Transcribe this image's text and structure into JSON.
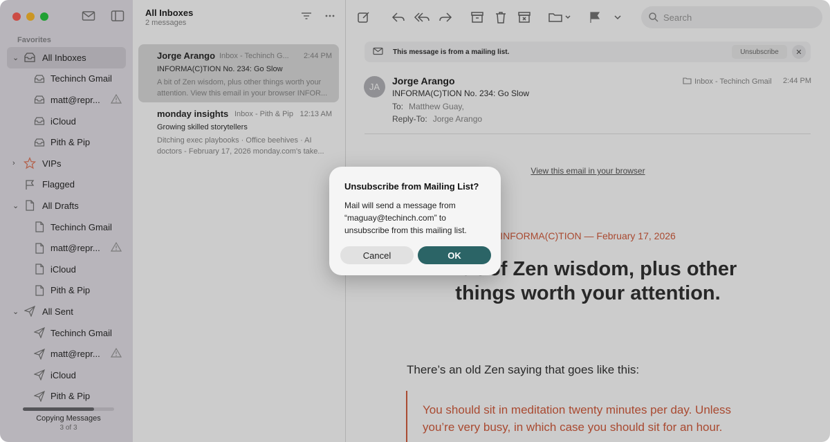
{
  "sidebar": {
    "section_label": "Favorites",
    "items": [
      {
        "label": "All Inboxes",
        "icon": "inbox-stack-icon",
        "level": "top",
        "chevron": "⌄",
        "selected": true
      },
      {
        "label": "Techinch Gmail",
        "icon": "inbox-icon",
        "level": "sub"
      },
      {
        "label": "matt@repr...",
        "icon": "inbox-icon",
        "level": "sub",
        "warning": true
      },
      {
        "label": "iCloud",
        "icon": "inbox-icon",
        "level": "sub"
      },
      {
        "label": "Pith & Pip",
        "icon": "inbox-icon",
        "level": "sub"
      },
      {
        "label": "VIPs",
        "icon": "star-icon",
        "level": "top",
        "chevron": "›"
      },
      {
        "label": "Flagged",
        "icon": "flag-icon",
        "level": "top"
      },
      {
        "label": "All Drafts",
        "icon": "document-icon",
        "level": "top",
        "chevron": "⌄"
      },
      {
        "label": "Techinch Gmail",
        "icon": "document-icon",
        "level": "sub"
      },
      {
        "label": "matt@repr...",
        "icon": "document-icon",
        "level": "sub",
        "warning": true
      },
      {
        "label": "iCloud",
        "icon": "document-icon",
        "level": "sub"
      },
      {
        "label": "Pith & Pip",
        "icon": "document-icon",
        "level": "sub"
      },
      {
        "label": "All Sent",
        "icon": "paperplane-icon",
        "level": "top",
        "chevron": "⌄"
      },
      {
        "label": "Techinch Gmail",
        "icon": "paperplane-icon",
        "level": "sub"
      },
      {
        "label": "matt@repr...",
        "icon": "paperplane-icon",
        "level": "sub",
        "warning": true
      },
      {
        "label": "iCloud",
        "icon": "paperplane-icon",
        "level": "sub"
      },
      {
        "label": "Pith & Pip",
        "icon": "paperplane-icon",
        "level": "sub"
      }
    ],
    "progress": {
      "label": "Copying Messages",
      "sub": "3 of 3",
      "fraction": 0.78
    }
  },
  "list": {
    "title": "All Inboxes",
    "count": "2 messages",
    "messages": [
      {
        "sender": "Jorge Arango",
        "mailbox": "Inbox - Techinch G...",
        "time": "2:44 PM",
        "subject": "INFORMA(C)TION No. 234: Go Slow",
        "preview": "A bit of Zen wisdom, plus other things worth your attention. View this email in your browser INFOR..."
      },
      {
        "sender": "monday insights",
        "mailbox": "Inbox - Pith & Pip",
        "time": "12:13 AM",
        "subject": "Growing skilled storytellers",
        "preview": "Ditching exec playbooks · Office beehives · AI doctors - February 17, 2026 monday.com's take..."
      }
    ]
  },
  "pane": {
    "search_placeholder": "Search",
    "banner_text": "This message is from a mailing list.",
    "unsubscribe_label": "Unsubscribe",
    "close_glyph": "✕",
    "avatar_initials": "JA",
    "sender": "Jorge Arango",
    "subject": "INFORMA(C)TION No. 234: Go Slow",
    "to_label": "To:",
    "to_value": "Matthew Guay,",
    "reply_to_label": "Reply-To:",
    "reply_to_value": "Jorge Arango",
    "mailbox": "Inbox - Techinch Gmail",
    "time": "2:44 PM",
    "view_in_browser": "View this email in your browser",
    "issue_line": "INFORMA(C)TION — February 17, 2026",
    "headline": "A bit of Zen wisdom, plus other things worth your attention.",
    "body_intro": "There’s an old Zen saying that goes like this:",
    "quote": "You should sit in meditation twenty minutes per day. Unless you’re very busy, in which case you should sit for an hour."
  },
  "dialog": {
    "title": "Unsubscribe from Mailing List?",
    "message": "Mail will send a message from “maguay@techinch.com” to unsubscribe from this mailing list.",
    "cancel": "Cancel",
    "ok": "OK"
  },
  "colors": {
    "accent": "#2b6466",
    "quote": "#d45d3e"
  }
}
